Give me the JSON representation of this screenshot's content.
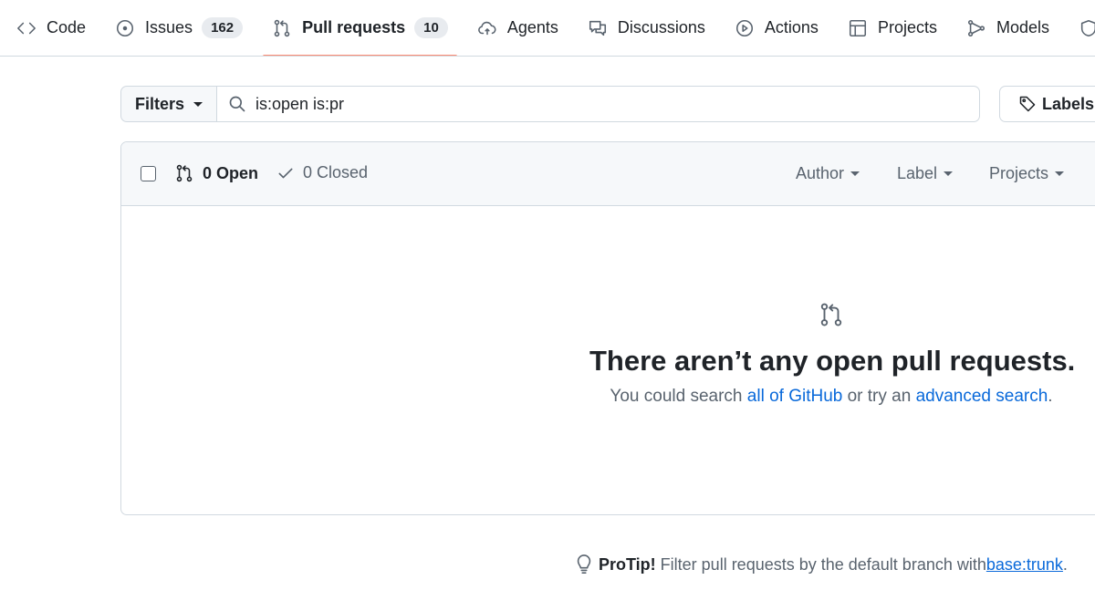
{
  "nav": {
    "tabs": [
      {
        "label": "Code",
        "icon": "code-icon"
      },
      {
        "label": "Issues",
        "count": "162",
        "icon": "issue-opened-icon"
      },
      {
        "label": "Pull requests",
        "count": "10",
        "icon": "git-pull-request-icon",
        "active": true
      },
      {
        "label": "Agents",
        "icon": "agent-cloud-icon"
      },
      {
        "label": "Discussions",
        "icon": "comment-discussion-icon"
      },
      {
        "label": "Actions",
        "icon": "play-icon"
      },
      {
        "label": "Projects",
        "icon": "table-icon"
      },
      {
        "label": "Models",
        "icon": "models-icon"
      }
    ]
  },
  "filter_bar": {
    "filters_label": "Filters",
    "search_value": "is:open is:pr",
    "labels_label": "Labels"
  },
  "list": {
    "open_label": "0 Open",
    "closed_label": "0 Closed",
    "author_label": "Author",
    "label_label": "Label",
    "projects_label": "Projects"
  },
  "empty": {
    "icon": "git-pull-request-icon",
    "title": "There aren’t any open pull requests.",
    "sub_pre": "You could search ",
    "sub_link1": "all of GitHub",
    "sub_mid": " or try an ",
    "sub_link2": "advanced search",
    "sub_post": "."
  },
  "protip": {
    "icon": "light-bulb-icon",
    "bold": "ProTip!",
    "text": "Filter pull requests by the default branch with ",
    "link": "base:trunk",
    "end": "."
  },
  "colors": {
    "accent_underline": "#fd8c73",
    "link": "#0969da",
    "border": "#d1d9e0",
    "header_bg": "#f6f8fa"
  }
}
